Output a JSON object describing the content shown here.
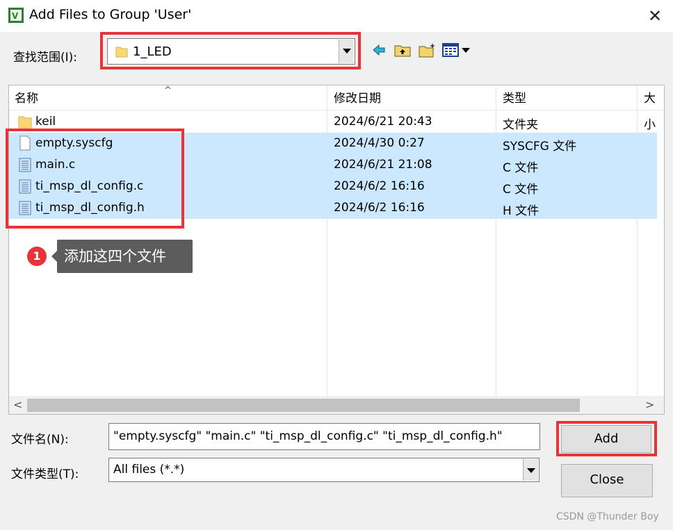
{
  "window": {
    "title": "Add Files to Group 'User'",
    "close_glyph": "✕",
    "app_icon": "keil-uvision-icon"
  },
  "lookin": {
    "label": "查找范围(I):",
    "value": "1_LED"
  },
  "toolbar": {
    "icons": [
      "back-arrow-icon",
      "up-folder-icon",
      "new-folder-icon",
      "view-menu-icon"
    ]
  },
  "columns": [
    "名称",
    "修改日期",
    "类型",
    "大小"
  ],
  "files": [
    {
      "name": "keil",
      "date": "2024/6/21 20:43",
      "type": "文件夹",
      "icon": "folder-icon",
      "selected": false
    },
    {
      "name": "empty.syscfg",
      "date": "2024/4/30 0:27",
      "type": "SYSCFG 文件",
      "icon": "file-icon",
      "selected": true
    },
    {
      "name": "main.c",
      "date": "2024/6/21 21:08",
      "type": "C 文件",
      "icon": "c-file-icon",
      "selected": true
    },
    {
      "name": "ti_msp_dl_config.c",
      "date": "2024/6/2 16:16",
      "type": "C 文件",
      "icon": "c-file-icon",
      "selected": true
    },
    {
      "name": "ti_msp_dl_config.h",
      "date": "2024/6/2 16:16",
      "type": "H 文件",
      "icon": "h-file-icon",
      "selected": true
    }
  ],
  "annotation": {
    "number": "1",
    "text": "添加这四个文件"
  },
  "filename": {
    "label": "文件名(N):",
    "value": "\"empty.syscfg\" \"main.c\" \"ti_msp_dl_config.c\" \"ti_msp_dl_config.h\""
  },
  "filetype": {
    "label": "文件类型(T):",
    "value": "All files (*.*)"
  },
  "buttons": {
    "add": "Add",
    "close": "Close"
  },
  "watermark": "CSDN @Thunder Boy",
  "colors": {
    "highlight_red": "#e8333a",
    "selection": "#cce8ff"
  }
}
